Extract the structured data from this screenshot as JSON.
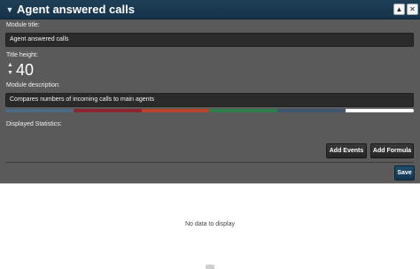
{
  "window": {
    "title": "Agent answered calls",
    "icons": [
      "chevron-down-icon",
      "pin-icon",
      "close-icon"
    ]
  },
  "form": {
    "module_title_label": "Module title:",
    "module_title_value": "Agent answered calls",
    "title_height_label": "Title height:",
    "title_height_value": "40",
    "module_description_label": "Module description:",
    "module_description_value": "Compares numbers of incoming calls to main agents",
    "palette": [
      "#4a6a86",
      "#8c2530",
      "#b9432a",
      "#2f7c4d",
      "#3f5670",
      "#ffffff"
    ],
    "displayed_statistics_label": "Displayed Statistics:"
  },
  "buttons": {
    "add_events": "Add Events",
    "add_formula": "Add Formula",
    "save": "Save"
  },
  "content": {
    "empty_message": "No data to display"
  }
}
